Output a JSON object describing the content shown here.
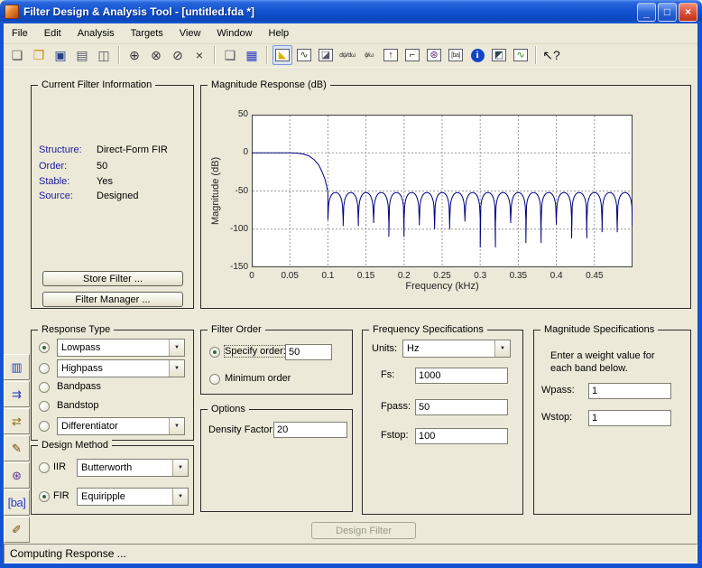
{
  "colors": {
    "titlebar_blue": "#1353d2",
    "background": "#ece9d8",
    "plot_line": "#000080",
    "label_blue": "#1a1a9c",
    "close_red": "#dd5038"
  },
  "window": {
    "title": "Filter Design & Analysis Tool -  [untitled.fda *]",
    "controls": {
      "minimize": "_",
      "maximize": "□",
      "close": "×"
    }
  },
  "menu": {
    "items": [
      "File",
      "Edit",
      "Analysis",
      "Targets",
      "View",
      "Window",
      "Help"
    ]
  },
  "toolbar": {
    "buttons": [
      {
        "name": "new-session-icon",
        "glyph": "❏",
        "color": "#555555"
      },
      {
        "name": "open-session-icon",
        "glyph": "❐",
        "color": "#c89010"
      },
      {
        "name": "save-session-icon",
        "glyph": "▣",
        "color": "#27408b"
      },
      {
        "name": "print-icon",
        "glyph": "▤",
        "color": "#555566"
      },
      {
        "name": "print-preview-icon",
        "glyph": "◫",
        "color": "#555566"
      },
      {
        "sep": true
      },
      {
        "name": "zoom-in-icon",
        "glyph": "⊕",
        "color": "#333333"
      },
      {
        "name": "zoom-x-icon",
        "glyph": "⊗",
        "color": "#333333"
      },
      {
        "name": "zoom-y-icon",
        "glyph": "⊘",
        "color": "#333333"
      },
      {
        "name": "full-view-icon",
        "glyph": "×",
        "color": "#333333"
      },
      {
        "sep": true
      },
      {
        "name": "copy-session-icon",
        "glyph": "❑",
        "color": "#555566"
      },
      {
        "name": "filter-manager-icon",
        "glyph": "▦",
        "color": "#2a3ec0"
      },
      {
        "sep": true
      },
      {
        "name": "magnitude-response-icon",
        "glyph": "◣",
        "color": "#d9b300",
        "selected": true,
        "boxed": true
      },
      {
        "name": "phase-response-icon",
        "glyph": "∿",
        "color": "#333333",
        "boxed": true
      },
      {
        "name": "magnitude-phase-icon",
        "glyph": "◪",
        "color": "#556",
        "boxed": true
      },
      {
        "name": "group-delay-icon",
        "glyph": "dψ/dω",
        "color": "#333333",
        "small": true
      },
      {
        "name": "phase-delay-icon",
        "glyph": "ϕ/ω",
        "color": "#333333",
        "small": true
      },
      {
        "name": "impulse-response-icon",
        "glyph": "↑",
        "color": "#333333",
        "boxed": true
      },
      {
        "name": "step-response-icon",
        "glyph": "⌐",
        "color": "#333333",
        "boxed": true
      },
      {
        "name": "pole-zero-plot-icon",
        "glyph": "⊛",
        "color": "#5b2d8e",
        "boxed": true
      },
      {
        "name": "filter-coefficients-icon",
        "glyph": "[ba]",
        "color": "#333333",
        "boxed": true,
        "small": true
      },
      {
        "name": "filter-info-icon",
        "glyph": "i",
        "color": "#ffffff",
        "bg": "#1445c8"
      },
      {
        "name": "spec-mask-icon",
        "glyph": "◩",
        "color": "#334455",
        "boxed": true
      },
      {
        "name": "noise-psd-icon",
        "glyph": "∿",
        "color": "#2a8a2a",
        "boxed": true
      },
      {
        "sep": true
      },
      {
        "name": "context-help-icon",
        "glyph": "↖?",
        "color": "#111111"
      }
    ]
  },
  "sidebar": {
    "buttons": [
      {
        "name": "realize-model-icon",
        "glyph": "▥",
        "color": "#2a3ec0"
      },
      {
        "name": "multirate-filter-icon",
        "glyph": "⇉",
        "color": "#2a3ec0"
      },
      {
        "name": "transform-filter-icon",
        "glyph": "⇄",
        "color": "#8a6a10"
      },
      {
        "name": "quantize-filter-icon",
        "glyph": "✎",
        "color": "#6a4a10"
      },
      {
        "name": "pole-zero-editor-icon",
        "glyph": "⊛",
        "color": "#5b2d8e"
      },
      {
        "name": "import-filter-icon",
        "glyph": "[ba]",
        "color": "#2a3ec0",
        "small": true
      },
      {
        "name": "design-filter-icon",
        "glyph": "✐",
        "color": "#6a4a10"
      }
    ]
  },
  "current_filter_info": {
    "title": "Current Filter Information",
    "rows": [
      {
        "label": "Structure:",
        "value": "Direct-Form FIR"
      },
      {
        "label": "Order:",
        "value": "50"
      },
      {
        "label": "Stable:",
        "value": "Yes"
      },
      {
        "label": "Source:",
        "value": "Designed"
      }
    ],
    "store_button": "Store Filter ...",
    "manager_button": "Filter Manager ..."
  },
  "response_type": {
    "title": "Response Type",
    "options": [
      {
        "key": "lowpass",
        "label": "Lowpass",
        "selected": true,
        "dropdown": "Lowpass"
      },
      {
        "key": "highpass",
        "label": "Highpass",
        "selected": false,
        "dropdown": "Highpass"
      },
      {
        "key": "bandpass",
        "label": "Bandpass",
        "selected": false
      },
      {
        "key": "bandstop",
        "label": "Bandstop",
        "selected": false
      },
      {
        "key": "differentiator",
        "label": "Differentiator",
        "selected": false,
        "dropdown": "Differentiator"
      }
    ]
  },
  "design_method": {
    "title": "Design Method",
    "options": [
      {
        "key": "iir",
        "label": "IIR",
        "selected": false,
        "dropdown": "Butterworth"
      },
      {
        "key": "fir",
        "label": "FIR",
        "selected": true,
        "dropdown": "Equiripple"
      }
    ]
  },
  "filter_order": {
    "title": "Filter Order",
    "specify_label": "Specify order:",
    "specify_value": "50",
    "specify_selected": true,
    "minimum_label": "Minimum order",
    "minimum_selected": false
  },
  "options": {
    "title": "Options",
    "density_label": "Density Factor:",
    "density_value": "20"
  },
  "frequency_specs": {
    "title": "Frequency Specifications",
    "units_label": "Units:",
    "units_value": "Hz",
    "fields": [
      {
        "name": "fs",
        "label": "Fs:",
        "value": "1000"
      },
      {
        "name": "fpass",
        "label": "Fpass:",
        "value": "50"
      },
      {
        "name": "fstop",
        "label": "Fstop:",
        "value": "100"
      }
    ]
  },
  "magnitude_specs": {
    "title": "Magnitude Specifications",
    "note_line1": "Enter a weight value for",
    "note_line2": "each band below.",
    "fields": [
      {
        "name": "wpass",
        "label": "Wpass:",
        "value": "1"
      },
      {
        "name": "wstop",
        "label": "Wstop:",
        "value": "1"
      }
    ]
  },
  "design_filter_button": {
    "label": "Design Filter",
    "enabled": false
  },
  "status_bar": {
    "text": "Computing Response ..."
  },
  "chart_data": {
    "type": "line",
    "title": "Magnitude Response (dB)",
    "xlabel": "Frequency (kHz)",
    "ylabel": "Magnitude (dB)",
    "xlim": [
      0,
      0.5
    ],
    "ylim": [
      -150,
      50
    ],
    "xticks": [
      0,
      0.05,
      0.1,
      0.15,
      0.2,
      0.25,
      0.3,
      0.35,
      0.4,
      0.45
    ],
    "yticks": [
      50,
      0,
      -50,
      -100,
      -150
    ],
    "grid": true,
    "legend": "none",
    "line_color": "#000080",
    "series": {
      "name": "Lowpass FIR equiripple magnitude response",
      "passband_level_db": 0,
      "passband_edge_khz": 0.05,
      "stopband_edge_khz": 0.1,
      "transition": [
        [
          0.05,
          0
        ],
        [
          0.06,
          -0.4
        ],
        [
          0.068,
          -1.6
        ],
        [
          0.075,
          -4
        ],
        [
          0.082,
          -9
        ],
        [
          0.088,
          -16
        ],
        [
          0.092,
          -24
        ],
        [
          0.096,
          -34
        ],
        [
          0.0985,
          -44
        ],
        [
          0.1,
          -52
        ]
      ],
      "stopband": {
        "start_khz": 0.1,
        "end_khz": 0.5,
        "peak_db": -52,
        "null_dbs": [
          -88,
          -96,
          -86,
          -92,
          -110,
          -88,
          -95,
          -100,
          -90,
          -86,
          -124,
          -92,
          -88,
          -118,
          -94,
          -86,
          -112,
          -90,
          -104,
          -96
        ]
      }
    }
  }
}
